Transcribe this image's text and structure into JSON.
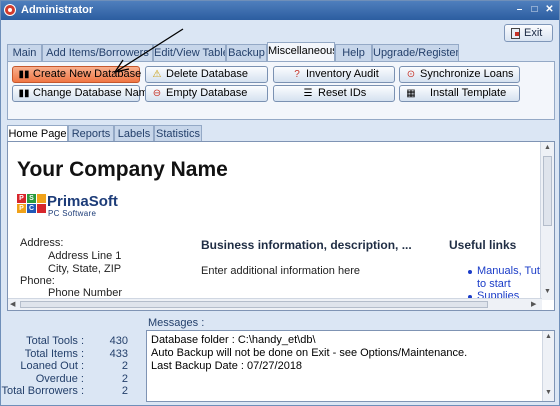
{
  "window": {
    "title": "Administrator"
  },
  "exit_label": "Exit",
  "main_tabs": [
    "Main",
    "Add Items/Borrowers",
    "Edit/View Table",
    "Backup",
    "Miscellaneous",
    "Help",
    "Upgrade/Register"
  ],
  "active_main_tab": "Miscellaneous",
  "toolbar": {
    "create_db": "Create New Database",
    "delete_db": "Delete Database",
    "inventory_audit": "Inventory Audit",
    "sync_loans": "Synchronize Loans",
    "change_db_name": "Change Database Name",
    "empty_db": "Empty Database",
    "reset_ids": "Reset IDs",
    "install_template": "Install Template"
  },
  "sub_tabs": [
    "Home Page",
    "Reports",
    "Labels",
    "Statistics"
  ],
  "active_sub_tab": "Home Page",
  "home": {
    "company_name": "Your Company Name",
    "logo_letters": [
      "P",
      "S",
      "P",
      "C"
    ],
    "logo_name": "PrimaSoft",
    "logo_sub": "PC Software",
    "address_label": "Address:",
    "address_line1": "Address Line 1",
    "address_city": "City, State, ZIP",
    "phone_label": "Phone:",
    "phone_number": "Phone Number",
    "business_title": "Business information, description, ...",
    "business_text": "Enter additional information here",
    "links_title": "Useful links",
    "link1_a": "Manuals, Tuto",
    "link1_b": "to start",
    "link2": "Supplies"
  },
  "messages_label": "Messages :",
  "stats": [
    {
      "name": "Total Tools :",
      "value": "430"
    },
    {
      "name": "Total Items :",
      "value": "433"
    },
    {
      "name": "Loaned Out :",
      "value": "2"
    },
    {
      "name": "Overdue :",
      "value": "2"
    },
    {
      "name": "Total Borrowers :",
      "value": "2"
    }
  ],
  "messages": [
    "Database folder : C:\\handy_et\\db\\",
    "Auto Backup will not be done on Exit - see Options/Maintenance.",
    "Last Backup Date : 07/27/2018"
  ],
  "colors": {
    "title_bar": "#2c5da0",
    "highlight_button": "#f07645",
    "link": "#1a3cc8"
  }
}
